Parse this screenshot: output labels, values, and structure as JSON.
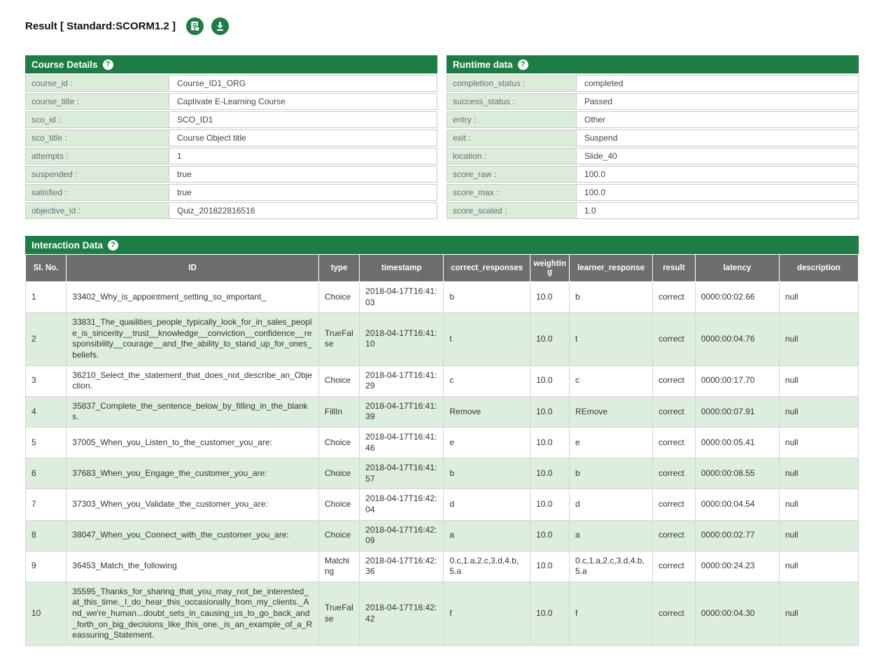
{
  "header": {
    "title": "Result [ Standard:SCORM1.2 ]"
  },
  "icons": {
    "report": "report-icon",
    "download": "download-icon",
    "help": "help-icon"
  },
  "colors": {
    "header_green": "#1e7d45",
    "label_light_green": "#dcecdb",
    "alt_row_light_green": "#deeede",
    "table_head_gray": "#6e6e6e"
  },
  "panels": {
    "course_details": {
      "title": "Course Details",
      "help": "?",
      "rows": [
        {
          "label": "course_id :",
          "value": "Course_ID1_ORG"
        },
        {
          "label": "course_title :",
          "value": "Captivate E-Learning Course"
        },
        {
          "label": "sco_id :",
          "value": "SCO_ID1"
        },
        {
          "label": "sco_title :",
          "value": "Course Object title"
        },
        {
          "label": "attempts :",
          "value": "1"
        },
        {
          "label": "suspended :",
          "value": "true"
        },
        {
          "label": "satisfied :",
          "value": "true"
        },
        {
          "label": "objective_id :",
          "value": "Quiz_201822816516"
        }
      ]
    },
    "runtime_data": {
      "title": "Runtime data",
      "help": "?",
      "rows": [
        {
          "label": "completion_status :",
          "value": "completed"
        },
        {
          "label": "success_status :",
          "value": "Passed"
        },
        {
          "label": "entry :",
          "value": "Other"
        },
        {
          "label": "exit :",
          "value": "Suspend"
        },
        {
          "label": "location :",
          "value": "Slide_40"
        },
        {
          "label": "score_raw :",
          "value": "100.0"
        },
        {
          "label": "score_max :",
          "value": "100.0"
        },
        {
          "label": "score_scaled :",
          "value": "1.0"
        }
      ]
    },
    "interaction_data": {
      "title": "Interaction Data",
      "help": "?",
      "columns": [
        "Sl. No.",
        "ID",
        "type",
        "timestamp",
        "correct_responses",
        "weighting",
        "learner_response",
        "result",
        "latency",
        "description"
      ],
      "rows": [
        [
          "1",
          "33402_Why_is_appointment_setting_so_important_",
          "Choice",
          "2018-04-17T16:41:03",
          "b",
          "10.0",
          "b",
          "correct",
          "0000:00:02.66",
          "null"
        ],
        [
          "2",
          "33831_The_quailities_people_typically_look_for_in_sales_people_is_sincerity__trust__knowledge__conviction__confidence__responsibility__courage__and_the_ability_to_stand_up_for_ones_beliefs.",
          "TrueFalse",
          "2018-04-17T16:41:10",
          "t",
          "10.0",
          "t",
          "correct",
          "0000:00:04.76",
          "null"
        ],
        [
          "3",
          "36210_Select_the_statement_that_does_not_describe_an_Objection.",
          "Choice",
          "2018-04-17T16:41:29",
          "c",
          "10.0",
          "c",
          "correct",
          "0000:00:17.70",
          "null"
        ],
        [
          "4",
          "35837_Complete_the_sentence_below_by_filling_in_the_blanks.",
          "FillIn",
          "2018-04-17T16:41:39",
          "Remove",
          "10.0",
          "REmove",
          "correct",
          "0000:00:07.91",
          "null"
        ],
        [
          "5",
          "37005_When_you_Listen_to_the_customer_you_are:",
          "Choice",
          "2018-04-17T16:41:46",
          "e",
          "10.0",
          "e",
          "correct",
          "0000:00:05.41",
          "null"
        ],
        [
          "6",
          "37683_When_you_Engage_the_customer_you_are:",
          "Choice",
          "2018-04-17T16:41:57",
          "b",
          "10.0",
          "b",
          "correct",
          "0000:00:08.55",
          "null"
        ],
        [
          "7",
          "37303_When_you_Validate_the_customer_you_are:",
          "Choice",
          "2018-04-17T16:42:04",
          "d",
          "10.0",
          "d",
          "correct",
          "0000:00:04.54",
          "null"
        ],
        [
          "8",
          "38047_When_you_Connect_with_the_customer_you_are:",
          "Choice",
          "2018-04-17T16:42:09",
          "a",
          "10.0",
          "a",
          "correct",
          "0000:00:02.77",
          "null"
        ],
        [
          "9",
          "36453_Match_the_following",
          "Matching",
          "2018-04-17T16:42:36",
          "0.c,1.a,2.c,3.d,4.b,5.a",
          "10.0",
          "0.c,1.a,2.c,3.d,4.b,5.a",
          "correct",
          "0000:00:24.23",
          "null"
        ],
        [
          "10",
          "35595_Thanks_for_sharing_that_you_may_not_be_interested_at_this_time._I_do_hear_this_occasionally_from_my_clients._And_we're_human...doubt_sets_in_causing_us_to_go_back_and_forth_on_big_decisions_like_this_one._is_an_example_of_a_Reassuring_Statement.",
          "TrueFalse",
          "2018-04-17T16:42:42",
          "f",
          "10.0",
          "f",
          "correct",
          "0000:00:04.30",
          "null"
        ]
      ]
    }
  }
}
